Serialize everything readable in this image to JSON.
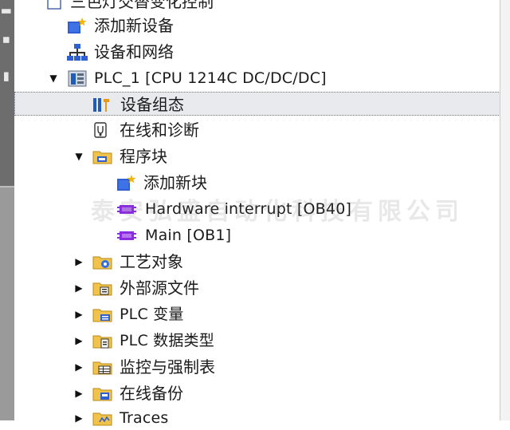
{
  "colors": {
    "side_strip": "#6d6d6d",
    "selection_bg": "#e9eaee",
    "folder_yellow": "#f1c34b",
    "block_purple": "#8a2be2",
    "accent_blue": "#2f6fe0"
  },
  "watermark": "泰安弘盛自动化科技有限公司",
  "tree": {
    "items": [
      {
        "label": "三色灯交替变化控制",
        "icon": "project-icon",
        "expanded": null
      },
      {
        "label": "添加新设备",
        "icon": "add-device-icon",
        "expanded": null
      },
      {
        "label": "设备和网络",
        "icon": "network-icon",
        "expanded": null
      },
      {
        "label": "PLC_1 [CPU 1214C DC/DC/DC]",
        "icon": "plc-icon",
        "expanded": true
      },
      {
        "label": "设备组态",
        "icon": "device-config-icon",
        "expanded": null,
        "selected": true
      },
      {
        "label": "在线和诊断",
        "icon": "diagnostics-icon",
        "expanded": null
      },
      {
        "label": "程序块",
        "icon": "program-blocks-folder-icon",
        "expanded": true
      },
      {
        "label": "添加新块",
        "icon": "add-block-icon",
        "expanded": null
      },
      {
        "label": "Hardware interrupt [OB40]",
        "icon": "ob-block-icon",
        "expanded": null
      },
      {
        "label": "Main [OB1]",
        "icon": "ob-block-icon",
        "expanded": null
      },
      {
        "label": "工艺对象",
        "icon": "technology-objects-folder-icon",
        "expanded": false
      },
      {
        "label": "外部源文件",
        "icon": "external-source-folder-icon",
        "expanded": false
      },
      {
        "label": "PLC 变量",
        "icon": "plc-tags-folder-icon",
        "expanded": false
      },
      {
        "label": "PLC 数据类型",
        "icon": "plc-datatypes-folder-icon",
        "expanded": false
      },
      {
        "label": "监控与强制表",
        "icon": "watch-force-tables-folder-icon",
        "expanded": false
      },
      {
        "label": "在线备份",
        "icon": "online-backups-folder-icon",
        "expanded": false
      },
      {
        "label": "Traces",
        "icon": "traces-folder-icon",
        "expanded": false
      }
    ]
  }
}
